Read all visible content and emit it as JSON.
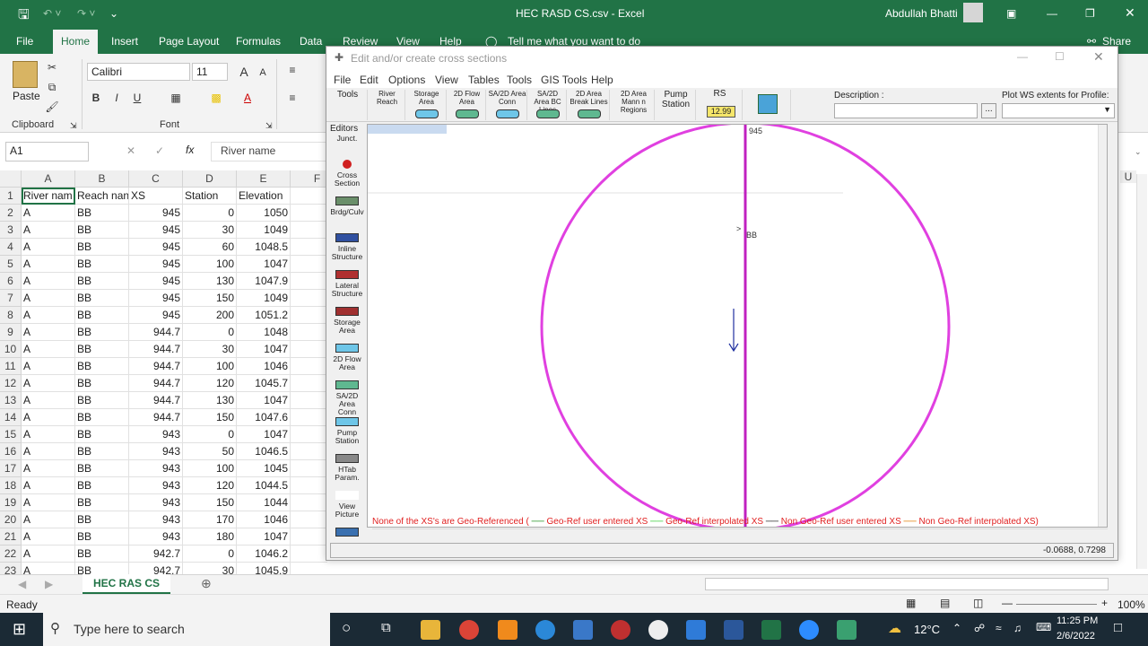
{
  "excel": {
    "title": "HEC RASD CS.csv  -  Excel",
    "user": "Abdullah Bhatti",
    "share": "Share",
    "tabs": [
      "File",
      "Home",
      "Insert",
      "Page Layout",
      "Formulas",
      "Data",
      "Review",
      "View",
      "Help"
    ],
    "tell_me": "Tell me what you want to do",
    "ribbon": {
      "paste": "Paste",
      "clipboard": "Clipboard",
      "font_group": "Font",
      "font_name": "Calibri",
      "font_size": "11",
      "bold": "B",
      "italic": "I",
      "underline": "U",
      "grow": "A",
      "shrink": "A"
    },
    "name_box": "A1",
    "formula": "River name",
    "fx": "fx",
    "columns": [
      "A",
      "B",
      "C",
      "D",
      "E",
      "F"
    ],
    "header_row": [
      "River nam",
      "Reach nan",
      "XS",
      "Station",
      "Elevation"
    ],
    "rows": [
      [
        "A",
        "BB",
        "945",
        "0",
        "1050"
      ],
      [
        "A",
        "BB",
        "945",
        "30",
        "1049"
      ],
      [
        "A",
        "BB",
        "945",
        "60",
        "1048.5"
      ],
      [
        "A",
        "BB",
        "945",
        "100",
        "1047"
      ],
      [
        "A",
        "BB",
        "945",
        "130",
        "1047.9"
      ],
      [
        "A",
        "BB",
        "945",
        "150",
        "1049"
      ],
      [
        "A",
        "BB",
        "945",
        "200",
        "1051.2"
      ],
      [
        "A",
        "BB",
        "944.7",
        "0",
        "1048"
      ],
      [
        "A",
        "BB",
        "944.7",
        "30",
        "1047"
      ],
      [
        "A",
        "BB",
        "944.7",
        "100",
        "1046"
      ],
      [
        "A",
        "BB",
        "944.7",
        "120",
        "1045.7"
      ],
      [
        "A",
        "BB",
        "944.7",
        "130",
        "1047"
      ],
      [
        "A",
        "BB",
        "944.7",
        "150",
        "1047.6"
      ],
      [
        "A",
        "BB",
        "943",
        "0",
        "1047"
      ],
      [
        "A",
        "BB",
        "943",
        "50",
        "1046.5"
      ],
      [
        "A",
        "BB",
        "943",
        "100",
        "1045"
      ],
      [
        "A",
        "BB",
        "943",
        "120",
        "1044.5"
      ],
      [
        "A",
        "BB",
        "943",
        "150",
        "1044"
      ],
      [
        "A",
        "BB",
        "943",
        "170",
        "1046"
      ],
      [
        "A",
        "BB",
        "943",
        "180",
        "1047"
      ],
      [
        "A",
        "BB",
        "942.7",
        "0",
        "1046.2"
      ],
      [
        "A",
        "BB",
        "942.7",
        "30",
        "1045.9"
      ]
    ],
    "row_numbers": [
      "1",
      "2",
      "3",
      "4",
      "5",
      "6",
      "7",
      "8",
      "9",
      "10",
      "11",
      "12",
      "13",
      "14",
      "15",
      "16",
      "17",
      "18",
      "19",
      "20",
      "21",
      "22",
      "23"
    ],
    "sheet_tab": "HEC RAS CS",
    "status": "Ready",
    "zoom": "100%",
    "right_col": "U"
  },
  "hec": {
    "title": "Edit and/or create cross sections",
    "menu": [
      "File",
      "Edit",
      "Options",
      "View",
      "Tables",
      "Tools",
      "GIS Tools",
      "Help"
    ],
    "toolbar": {
      "tools": "Tools",
      "river_reach": "River Reach",
      "storage": "Storage Area",
      "flow2d": "2D Flow Area",
      "sa2d_conn": "SA/2D Area Conn",
      "sa2d_bc": "SA/2D Area BC Lines",
      "breaklines": "2D Area Break Lines",
      "mann": "2D Area Mann n Regions",
      "pump": "Pump Station",
      "rs": "RS",
      "rs_value": "12.99",
      "description": "Description :",
      "plot_ws": "Plot WS extents for Profile:"
    },
    "editors_label": "Editors",
    "editors": [
      "Junct.",
      "Cross Section",
      "Brdg/Culv",
      "Inline Structure",
      "Lateral Structure",
      "Storage Area",
      "2D Flow Area",
      "SA/2D Area Conn",
      "Pump Station",
      "HTab Param.",
      "View Picture"
    ],
    "xs_label": "945",
    "reach_label": "BB",
    "legend": {
      "prefix": "None of the XS's are Geo-Referenced (",
      "items": [
        "Geo-Ref user entered XS",
        "Geo-Ref interpolated XS",
        "Non Geo-Ref user entered XS",
        "Non Geo-Ref interpolated XS)"
      ],
      "colors": [
        "#1a8f1a",
        "#32cd32",
        "#222222",
        "#e07b00"
      ]
    },
    "coords": "-0.0688, 0.7298",
    "colors": {
      "circle": "#e040e0",
      "reach": "#c020c0",
      "arrow": "#2030a0"
    }
  },
  "taskbar": {
    "search": "Type here to search",
    "temp": "12°C",
    "time": "11:25 PM",
    "date": "2/6/2022"
  }
}
